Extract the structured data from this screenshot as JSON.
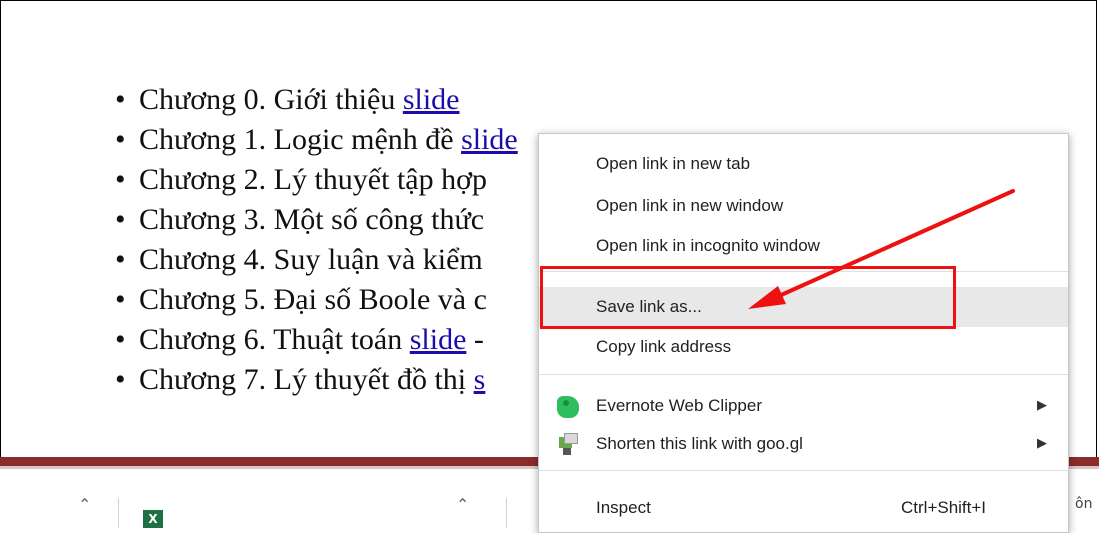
{
  "page": {
    "chapters": [
      {
        "bullet": "•",
        "text": "Chương 0. Giới thiệu ",
        "link": "slide",
        "tail": ""
      },
      {
        "bullet": "•",
        "text": "Chương 1. Logic mệnh đề ",
        "link": "slide",
        "tail": ""
      },
      {
        "bullet": "•",
        "text": "Chương 2. Lý thuyết tập hợp",
        "link": "",
        "tail": ""
      },
      {
        "bullet": "•",
        "text": "Chương 3. Một số công thức",
        "link": "",
        "tail": ""
      },
      {
        "bullet": "•",
        "text": "Chương 4. Suy luận và kiểm",
        "link": "",
        "tail": ""
      },
      {
        "bullet": "•",
        "text": "Chương 5. Đại số Boole và c",
        "link": "",
        "tail": ""
      },
      {
        "bullet": "•",
        "text": "Chương 6. Thuật toán ",
        "link": "slide",
        "tail": " -"
      },
      {
        "bullet": "•",
        "text": "Chương 7. Lý thuyết đồ thị ",
        "link": "s",
        "tail": ""
      }
    ]
  },
  "context_menu": {
    "items": [
      {
        "label": "Open link in new tab"
      },
      {
        "label": "Open link in new window"
      },
      {
        "label": "Open link in incognito window"
      },
      {
        "label": "Save link as..."
      },
      {
        "label": "Copy link address"
      },
      {
        "label": "Evernote Web Clipper",
        "arrow": "▶",
        "icon": "evernote-icon"
      },
      {
        "label": "Shorten this link with goo.gl",
        "arrow": "▶",
        "icon": "goo-gl-icon"
      },
      {
        "label": "Inspect",
        "shortcut": "Ctrl+Shift+I"
      }
    ]
  },
  "taskbar": {
    "chevron": "⌃",
    "excel_icon": "X",
    "right_text": "ôn"
  },
  "annotation": {
    "color": "#ee1111"
  }
}
